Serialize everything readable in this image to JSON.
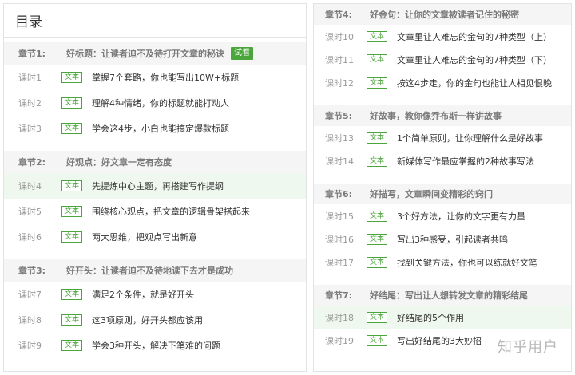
{
  "left": {
    "header": "目录",
    "chapters": [
      {
        "label": "章节1:",
        "title": "好标题：让读者迫不及待打开文章的秘诀",
        "badge": "试看",
        "lessons": [
          {
            "label": "课时1",
            "tag": "文本",
            "title": "掌握7个套路，你也能写出10W+标题"
          },
          {
            "label": "课时2",
            "tag": "文本",
            "title": "理解4种情绪，你的标题就能打动人"
          },
          {
            "label": "课时3",
            "tag": "文本",
            "title": "学会这4步，小白也能搞定爆款标题"
          }
        ]
      },
      {
        "label": "章节2:",
        "title": "好观点：好文章一定有态度",
        "lessons": [
          {
            "label": "课时4",
            "tag": "文本",
            "title": "先提炼中心主题，再搭建写作提纲"
          },
          {
            "label": "课时5",
            "tag": "文本",
            "title": "围绕核心观点，把文章的逻辑骨架搭起来"
          },
          {
            "label": "课时6",
            "tag": "文本",
            "title": "两大思维，把观点写出新意"
          }
        ]
      },
      {
        "label": "章节3:",
        "title": "好开头：让读者迫不及待地读下去才是成功",
        "lessons": [
          {
            "label": "课时7",
            "tag": "文本",
            "title": "满足2个条件，就是好开头"
          },
          {
            "label": "课时8",
            "tag": "文本",
            "title": "这3项原则，好开头都应该用"
          },
          {
            "label": "课时9",
            "tag": "文本",
            "title": "学会3种开头，解决下笔难的问题"
          }
        ]
      }
    ]
  },
  "right": {
    "chapters": [
      {
        "label": "章节4:",
        "title": "好金句：让你的文章被读者记住的秘密",
        "lessons": [
          {
            "label": "课时10",
            "tag": "文本",
            "title": "文章里让人难忘的金句的7种类型（上）"
          },
          {
            "label": "课时11",
            "tag": "文本",
            "title": "文章里让人难忘的金句的7种类型（下）"
          },
          {
            "label": "课时12",
            "tag": "文本",
            "title": "按这4步走，你的金句也能让人相见恨晚"
          }
        ]
      },
      {
        "label": "章节5:",
        "title": "好故事，教你像乔布斯一样讲故事",
        "lessons": [
          {
            "label": "课时13",
            "tag": "文本",
            "title": "1个简单原则，让你理解什么是好故事"
          },
          {
            "label": "课时14",
            "tag": "文本",
            "title": "新媒体写作最应掌握的2种故事写法"
          }
        ]
      },
      {
        "label": "章节6:",
        "title": "好描写，文章瞬间变精彩的窍门",
        "lessons": [
          {
            "label": "课时15",
            "tag": "文本",
            "title": "3个好方法，让你的文字更有力量"
          },
          {
            "label": "课时16",
            "tag": "文本",
            "title": "写出3种感受，引起读者共鸣"
          },
          {
            "label": "课时17",
            "tag": "文本",
            "title": "找到关键方法，你也可以练就好文笔"
          }
        ]
      },
      {
        "label": "章节7:",
        "title": "好结尾：写出让人想转发文章的精彩结尾",
        "lessons": [
          {
            "label": "课时18",
            "tag": "文本",
            "title": "好结尾的5个作用"
          },
          {
            "label": "课时19",
            "tag": "文本",
            "title": "写出好结尾的3大妙招"
          }
        ]
      }
    ]
  },
  "watermark": "知乎用户",
  "colors": {
    "accent": "#4aa53b",
    "active_row": "#eef8ee",
    "chapter_bg": "#f5f5f5"
  }
}
